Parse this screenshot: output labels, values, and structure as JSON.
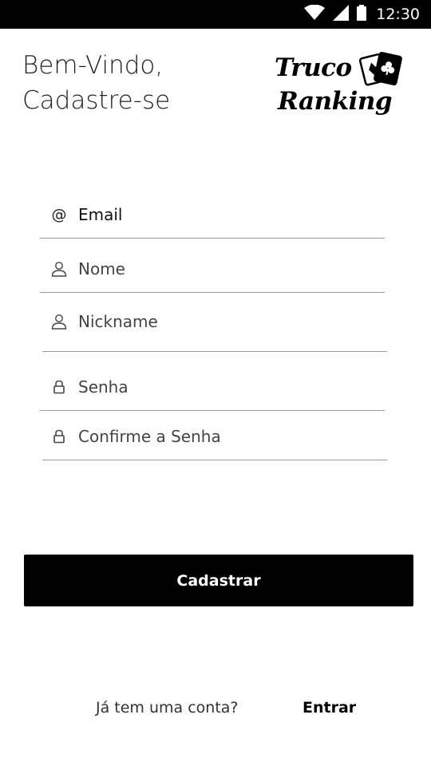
{
  "status_bar": {
    "time": "12:30",
    "icons": [
      "wifi-icon",
      "signal-icon",
      "battery-icon"
    ]
  },
  "header": {
    "welcome_line1": "Bem-Vindo,",
    "welcome_line2": "Cadastre-se"
  },
  "logo": {
    "line1": "Truco",
    "line2": "Ranking",
    "icon": "playing-cards-icon"
  },
  "form": {
    "email": {
      "placeholder": "Email",
      "value": "",
      "icon": "at-icon"
    },
    "name": {
      "placeholder": "Nome",
      "value": "",
      "icon": "user-icon"
    },
    "nickname": {
      "placeholder": "Nickname",
      "value": "",
      "icon": "user-icon"
    },
    "password": {
      "placeholder": "Senha",
      "value": "",
      "icon": "lock-icon"
    },
    "confirm_password": {
      "placeholder": "Confirme a Senha",
      "value": "",
      "icon": "lock-icon"
    }
  },
  "actions": {
    "register_label": "Cadastrar",
    "have_account_text": "Já tem uma conta?",
    "login_label": "Entrar"
  },
  "colors": {
    "primary": "#000000",
    "background": "#ffffff",
    "divider": "#9a9a9a"
  }
}
